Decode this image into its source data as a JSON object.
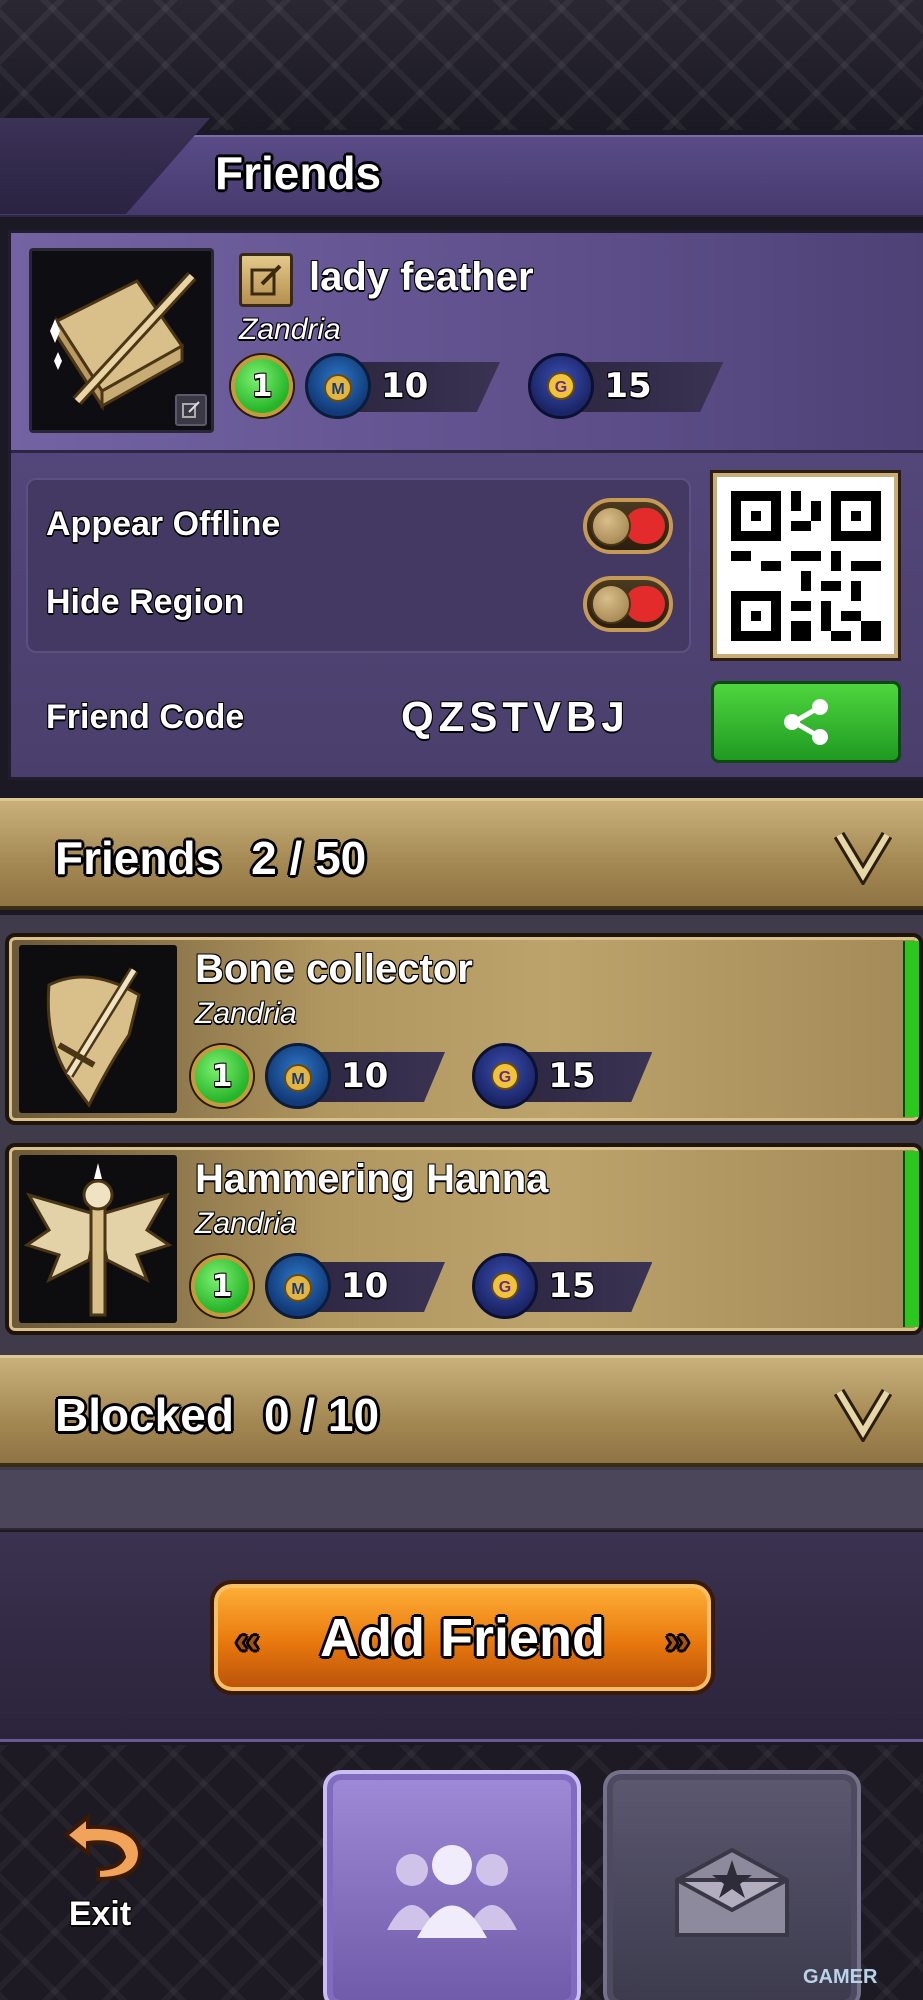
{
  "header": {
    "title": "Friends"
  },
  "profile": {
    "name": "lady feather",
    "region": "Zandria",
    "level": "1",
    "medals": "10",
    "coins": "15"
  },
  "settings": {
    "appear_offline_label": "Appear Offline",
    "hide_region_label": "Hide Region",
    "friend_code_label": "Friend Code",
    "friend_code": "QZSTVBJ"
  },
  "friends_section": {
    "title": "Friends",
    "count": "2 / 50",
    "list": [
      {
        "name": "Bone collector",
        "region": "Zandria",
        "level": "1",
        "medals": "10",
        "coins": "15"
      },
      {
        "name": "Hammering Hanna",
        "region": "Zandria",
        "level": "1",
        "medals": "10",
        "coins": "15"
      }
    ]
  },
  "blocked_section": {
    "title": "Blocked",
    "count": "0 / 10"
  },
  "add_friend_label": "Add Friend",
  "nav": {
    "exit_label": "Exit"
  },
  "watermark": "GAMER",
  "colors": {
    "header_purple": "#5a4b87",
    "section_gold": "#b0965f",
    "online_green": "#2ac71d",
    "toggle_red": "#e42b2b",
    "add_button_orange": "#e8780d"
  }
}
